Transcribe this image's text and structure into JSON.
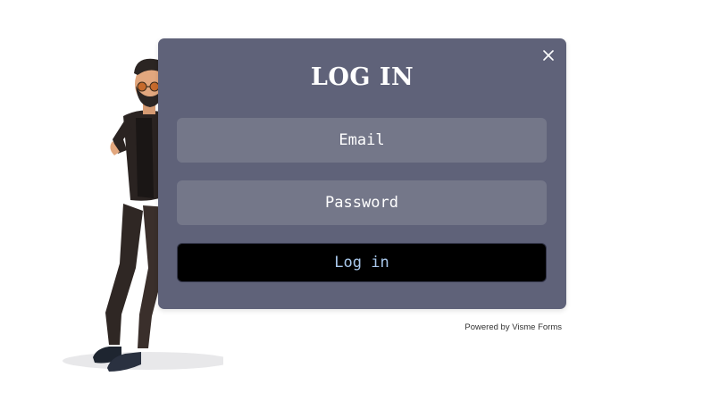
{
  "form": {
    "title": "LOG IN",
    "email_placeholder": "Email",
    "password_placeholder": "Password",
    "submit_label": "Log in",
    "close_icon": "close-icon"
  },
  "footer": {
    "powered_by": "Powered by Visme Forms"
  },
  "colors": {
    "modal_bg": "#5f6279",
    "field_bg": "#747789",
    "button_bg": "#000000",
    "button_text": "#a9c8ec"
  }
}
